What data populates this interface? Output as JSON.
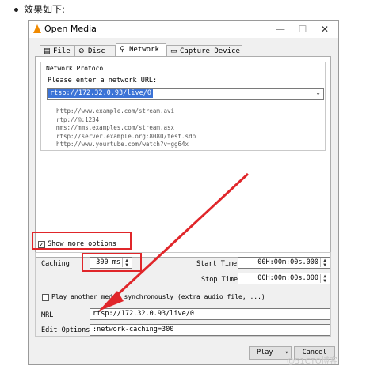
{
  "doc": {
    "heading": "效果如下:"
  },
  "window": {
    "title": "Open Media",
    "controls": {
      "minimize": "—",
      "maximize": "☐",
      "close": "✕"
    }
  },
  "tabs": [
    {
      "label": "File",
      "icon": "file-icon"
    },
    {
      "label": "Disc",
      "icon": "disc-icon"
    },
    {
      "label": "Network",
      "icon": "network-icon",
      "active": true
    },
    {
      "label": "Capture Device",
      "icon": "capture-device-icon"
    }
  ],
  "network": {
    "group_label": "Network Protocol",
    "prompt": "Please enter a network URL:",
    "url": "rtsp://172.32.0.93/live/0",
    "examples": [
      "http://www.example.com/stream.avi",
      "rtp://@:1234",
      "mms://mms.examples.com/stream.asx",
      "rtsp://server.example.org:8080/test.sdp",
      "http://www.yourtube.com/watch?v=gg64x"
    ]
  },
  "options": {
    "show_more": {
      "label": "Show more options",
      "checked": true
    },
    "caching": {
      "label": "Caching",
      "value": "300 ms"
    },
    "start_time": {
      "label": "Start Time",
      "value": "00H:00m:00s.000"
    },
    "stop_time": {
      "label": "Stop Time",
      "value": "00H:00m:00s.000"
    },
    "play_another": {
      "label": "Play another media synchronously (extra audio file, ...)",
      "checked": false
    },
    "mrl": {
      "label": "MRL",
      "value": "rtsp://172.32.0.93/live/0"
    },
    "edit_options": {
      "label": "Edit Options",
      "value": " :network-caching=300"
    }
  },
  "buttons": {
    "play": "Play",
    "cancel": "Cancel"
  },
  "watermark": "@51CTO博客",
  "colors": {
    "annotation": "#e0262a",
    "selection": "#3b73d6"
  }
}
